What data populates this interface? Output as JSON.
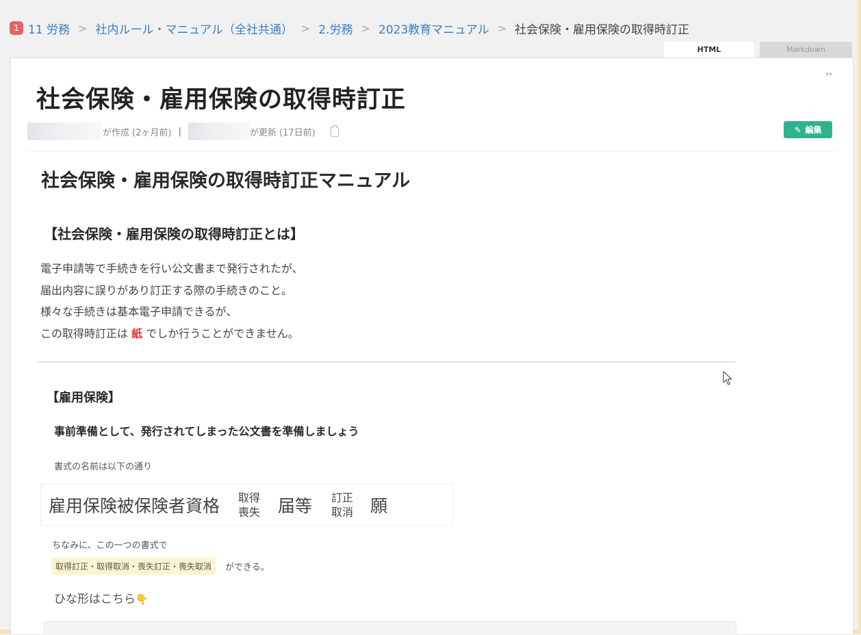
{
  "breadcrumb": {
    "badge": "1",
    "items": [
      "11 労務",
      "社内ルール・マニュアル（全社共通）",
      "2.労務",
      "2023教育マニュアル"
    ],
    "current": "社会保険・雇用保険の取得時訂正",
    "separator": ">"
  },
  "tabs": {
    "html": "HTML",
    "markdown": "Markdown"
  },
  "page": {
    "title": "社会保険・雇用保険の取得時訂正",
    "expand_icon": "↔",
    "meta": {
      "created": "が作成 (2ヶ月前)",
      "separator": "|",
      "updated": "が更新 (17日前)"
    },
    "edit_button": "編集"
  },
  "content": {
    "heading": "社会保険・雇用保険の取得時訂正マニュアル",
    "section1": {
      "heading": "【社会保険・雇用保険の取得時訂正とは】",
      "lines": [
        "電子申請等で手続きを行い公文書まで発行されたが、",
        "届出内容に誤りがあり訂正する際の手続きのこと。",
        "様々な手続きは基本電子申請できるが、"
      ],
      "last_line_before": "この取得時訂正は ",
      "last_line_emphasis": "紙",
      "last_line_after": " でしか行うことができません。"
    },
    "section2": {
      "heading": "【雇用保険】",
      "subheading": "事前準備として、発行されてしまった公文書を準備しましょう",
      "form_note": "書式の名前は以下の通り",
      "form_name": {
        "main": "雇用保険被保険者資格",
        "stack1_top": "取得",
        "stack1_bottom": "喪失",
        "todoke": "届等",
        "stack2_top": "訂正",
        "stack2_bottom": "取消",
        "negai": "願"
      },
      "note2": "ちなみに、この一つの書式で",
      "highlight": "取得訂正・取得取消・喪失訂正・喪失取消",
      "highlight_suffix": "ができる。",
      "template_text": "ひな形はこちら",
      "hand_emoji": "👇"
    }
  },
  "colors": {
    "link": "#3a7ec3",
    "edit_button": "#30b38d",
    "badge": "#e06666",
    "emphasis": "#e0352f",
    "highlight_bg": "#fdf4cf"
  }
}
